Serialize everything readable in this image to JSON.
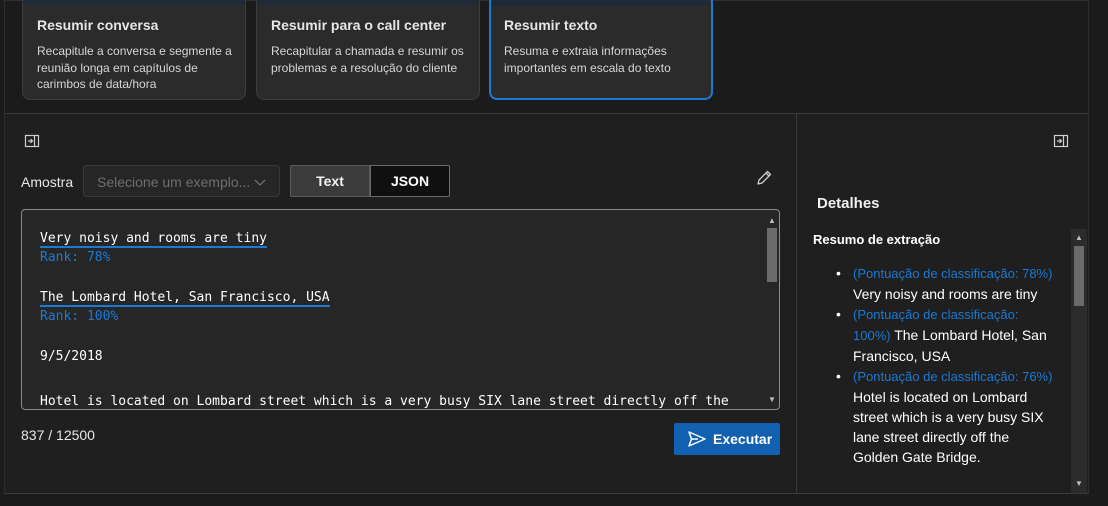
{
  "scenarios": [
    {
      "title": "Resumir conversa",
      "description": "Recapitule a conversa e segmente a reunião longa em capítulos de carimbos de data/hora",
      "selected": false
    },
    {
      "title": "Resumir para o call center",
      "description": "Recapitular a chamada e resumir os problemas e a resolução do cliente",
      "selected": false
    },
    {
      "title": "Resumir texto",
      "description": "Resuma e extraia informações importantes em escala do texto",
      "selected": true
    }
  ],
  "input": {
    "sample_label": "Amostra",
    "sample_placeholder": "Selecione um exemplo...",
    "toggle_text": "Text",
    "toggle_json": "JSON",
    "active_format": "JSON",
    "editor_lines": [
      "Very noisy and rooms are tiny",
      "Rank: 78%",
      "The Lombard Hotel, San Francisco, USA",
      "Rank: 100%",
      "9/5/2018",
      "Hotel is located on Lombard street which is a very busy SIX lane street directly off the"
    ],
    "char_count": "837 / 12500",
    "run_label": "Executar"
  },
  "details": {
    "title": "Detalhes",
    "subtitle": "Resumo de extração",
    "items": [
      {
        "score": "(Pontuação de classificação: 78%)",
        "text": "Very noisy and rooms are tiny"
      },
      {
        "score": "(Pontuação de classificação: 100%)",
        "text": "The Lombard Hotel, San Francisco, USA"
      },
      {
        "score": "(Pontuação de classificação: 76%)",
        "text": "Hotel is located on Lombard street which is a very busy SIX lane street directly off the Golden Gate Bridge."
      }
    ]
  },
  "icons": {
    "collapse_left": "panel-collapse-icon",
    "collapse_right": "panel-collapse-icon",
    "edit": "pencil-icon",
    "send": "send-icon",
    "dropdown": "chevron-down-icon"
  },
  "colors": {
    "accent": "#1c79d4",
    "button": "#1261b0",
    "background": "#1f1f1f"
  }
}
